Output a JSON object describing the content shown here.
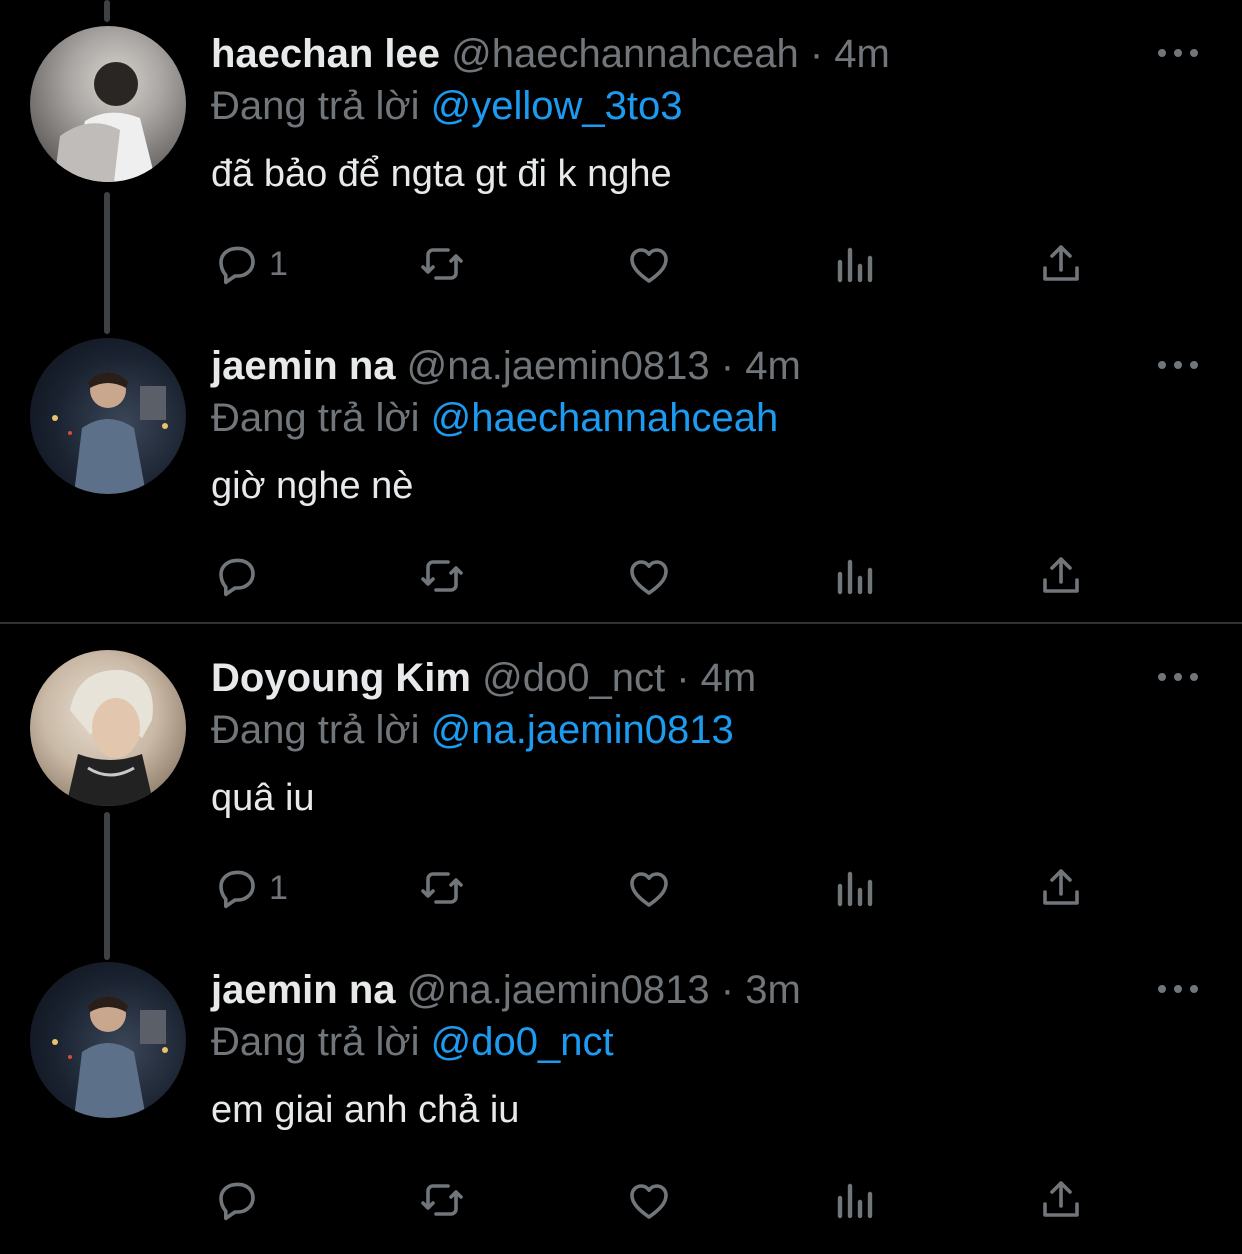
{
  "reply_prefix": "Đang trả lời",
  "tweets": [
    {
      "name": "haechan lee",
      "handle": "@haechannahceah",
      "time": "· 4m",
      "reply_to": "@yellow_3to3",
      "text": "đã bảo để ngta gt đi k nghe",
      "reply_count": "1"
    },
    {
      "name": "jaemin na",
      "handle": "@na.jaemin0813",
      "time": "· 4m",
      "reply_to": "@haechannahceah",
      "text": "giờ nghe nè",
      "reply_count": ""
    },
    {
      "name": "Doyoung Kim",
      "handle": "@do0_nct",
      "time": "· 4m",
      "reply_to": "@na.jaemin0813",
      "text": "quâ iu",
      "reply_count": "1"
    },
    {
      "name": "jaemin na",
      "handle": "@na.jaemin0813",
      "time": "· 3m",
      "reply_to": "@do0_nct",
      "text": "em giai anh chả iu",
      "reply_count": ""
    }
  ],
  "icons": {
    "reply": "reply-icon",
    "retweet": "retweet-icon",
    "like": "heart-icon",
    "views": "views-icon",
    "share": "share-icon",
    "more": "more-icon"
  },
  "colors": {
    "background": "#000000",
    "text": "#e7e9ea",
    "muted": "#71767b",
    "link": "#1d9bf0"
  }
}
